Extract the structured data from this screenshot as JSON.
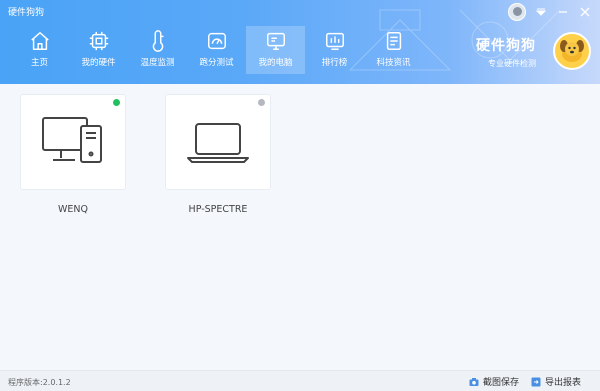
{
  "app": {
    "title": "硬件狗狗"
  },
  "nav": [
    {
      "label": "主页",
      "icon": "home-icon"
    },
    {
      "label": "我的硬件",
      "icon": "chip-icon"
    },
    {
      "label": "温度监测",
      "icon": "thermometer-icon"
    },
    {
      "label": "跑分测试",
      "icon": "speedometer-icon"
    },
    {
      "label": "我的电脑",
      "icon": "monitor-icon",
      "active": true
    },
    {
      "label": "排行榜",
      "icon": "bar-chart-icon"
    },
    {
      "label": "科技资讯",
      "icon": "news-icon"
    }
  ],
  "brand": {
    "name": "硬件狗狗",
    "subtitle": "专业硬件检测"
  },
  "devices": [
    {
      "name": "WENQ",
      "type": "desktop-icon",
      "status_color": "#22c15e"
    },
    {
      "name": "HP-SPECTRE",
      "type": "laptop-icon",
      "status_color": "#b5b9bf"
    }
  ],
  "statusbar": {
    "version": "程序版本:2.0.1.2",
    "screenshot_label": "截图保存",
    "export_label": "导出报表"
  },
  "colors": {
    "accent": "#4aa3f6",
    "online": "#22c15e",
    "offline": "#b5b9bf"
  }
}
